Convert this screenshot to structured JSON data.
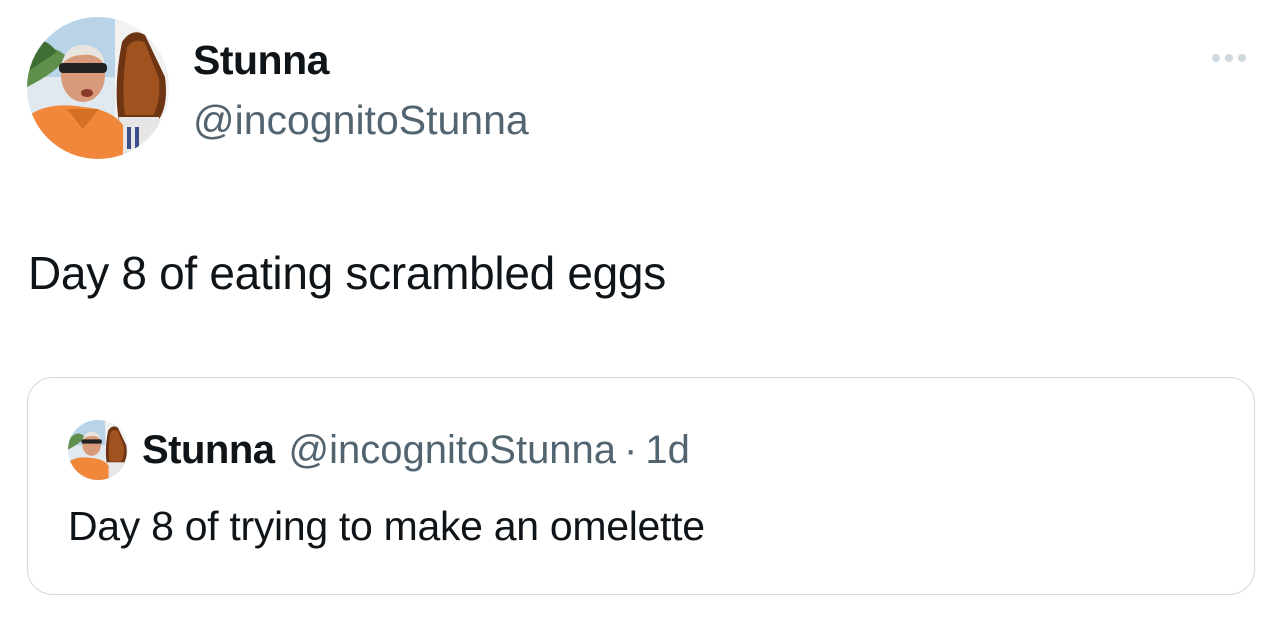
{
  "author": {
    "display_name": "Stunna",
    "handle": "@incognitoStunna"
  },
  "tweet": {
    "text": "Day 8 of eating scrambled eggs"
  },
  "quoted_tweet": {
    "display_name": "Stunna",
    "handle": "@incognitoStunna",
    "separator": "·",
    "time": "1d",
    "text": "Day 8 of trying to make an omelette"
  },
  "icons": {
    "more": "more-horizontal-icon",
    "avatar": "profile-photo"
  },
  "colors": {
    "text_primary": "#0f1419",
    "text_secondary": "#536471",
    "border": "#cfd9de",
    "more_dots": "#cfd9de",
    "background": "#ffffff"
  }
}
